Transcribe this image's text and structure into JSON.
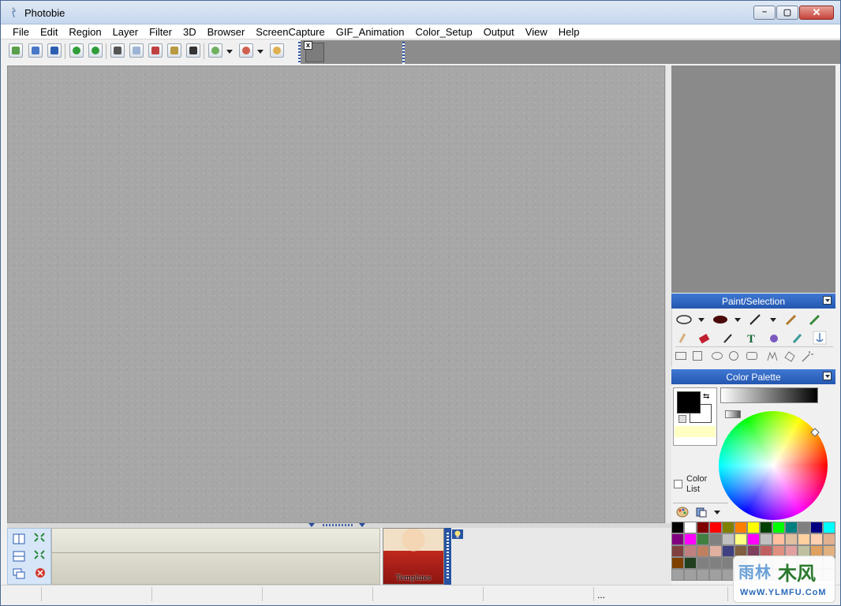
{
  "window": {
    "title": "Photobie",
    "minimize_glyph": "–",
    "maximize_glyph": "▢",
    "close_glyph": "✕"
  },
  "menu": [
    "File",
    "Edit",
    "Region",
    "Layer",
    "Filter",
    "3D",
    "Browser",
    "ScreenCapture",
    "GIF_Animation",
    "Color_Setup",
    "Output",
    "View",
    "Help"
  ],
  "floating_toolbar": {
    "close_glyph": "x"
  },
  "panels": {
    "paint_selection": {
      "title": "Paint/Selection"
    },
    "color_palette": {
      "title": "Color Palette",
      "color_list_label": "Color List",
      "foreground": "#000000",
      "background": "#ffffff",
      "current_color": "#ffffc4",
      "swatches": [
        "#000000",
        "#ffffff",
        "#800000",
        "#ff0000",
        "#808000",
        "#ff8000",
        "#ffff00",
        "#004000",
        "#00ff00",
        "#008080",
        "#808080",
        "#000080",
        "#00ffff",
        "#800080",
        "#ff00ff",
        "#408040",
        "#808080",
        "#c0c0c0",
        "#ffff80",
        "#ff00ff",
        "#c0c0c0",
        "#ffc0a0",
        "#e0c0a0",
        "#ffd0a0",
        "#ffd0b0",
        "#e0b090",
        "#804040",
        "#c08080",
        "#c08060",
        "#e0b0a0",
        "#404080",
        "#806040",
        "#804060",
        "#c06060",
        "#e09080",
        "#e0a0a0",
        "#c0c0a0",
        "#e0a060",
        "#e0b080",
        "#804000",
        "#204020",
        "#808080",
        "#808080",
        "#808080",
        "#808080",
        "#c0c0c0",
        "#c0c0c0",
        "#c0c0c0",
        "#c0c0c0",
        "#c0c0c0",
        "#c0c0c0",
        "#c0c0c0",
        "#a0a0a0",
        "#a0a0a0",
        "#a0a0a0",
        "#a0a0a0",
        "#a0a0a0",
        "#c0c0c0",
        "#c0c0c0",
        "#c0c0c0",
        "#c0c0c0",
        "#c0c0c0",
        "#c0c0c0",
        "#c0c0c0",
        "#c0c0c0"
      ]
    }
  },
  "templates": {
    "label": "Templates"
  },
  "statusbar": {
    "cells": [
      "",
      "",
      "",
      "",
      "",
      "",
      "...",
      ""
    ]
  },
  "watermark": {
    "line1": "雨林",
    "line2": "木风",
    "url": "WwW.YLMFU.CoM"
  },
  "colors": {
    "accent": "#2457b0",
    "workspace": "#a7a7a7"
  }
}
